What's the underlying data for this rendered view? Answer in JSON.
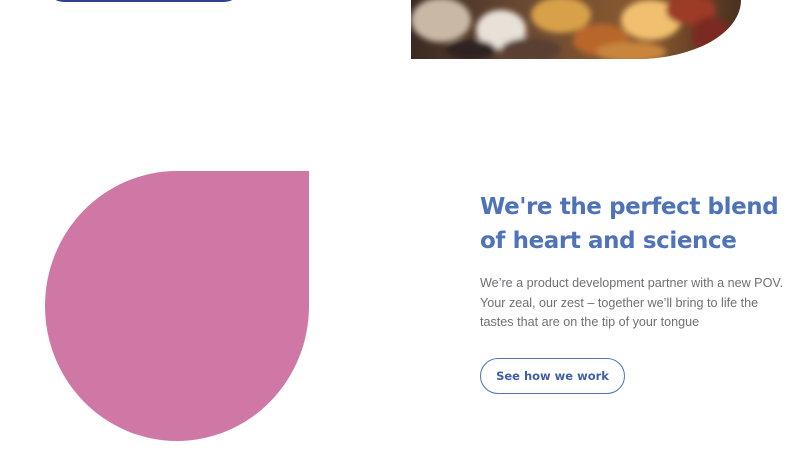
{
  "feature": {
    "title": "We're the perfect blend of heart and science",
    "body": "We’re a product development partner with a new POV. Your zeal, our zest – together we’ll bring to life the tastes that are on the tip of your tongue",
    "cta_label": "See how we work"
  },
  "colors": {
    "accent_blue": "#4f73b8",
    "dark_blue": "#2d3f8f",
    "pink_shape": "#cf78a5",
    "body_text": "#6f6f77",
    "background": "#ffffff"
  }
}
